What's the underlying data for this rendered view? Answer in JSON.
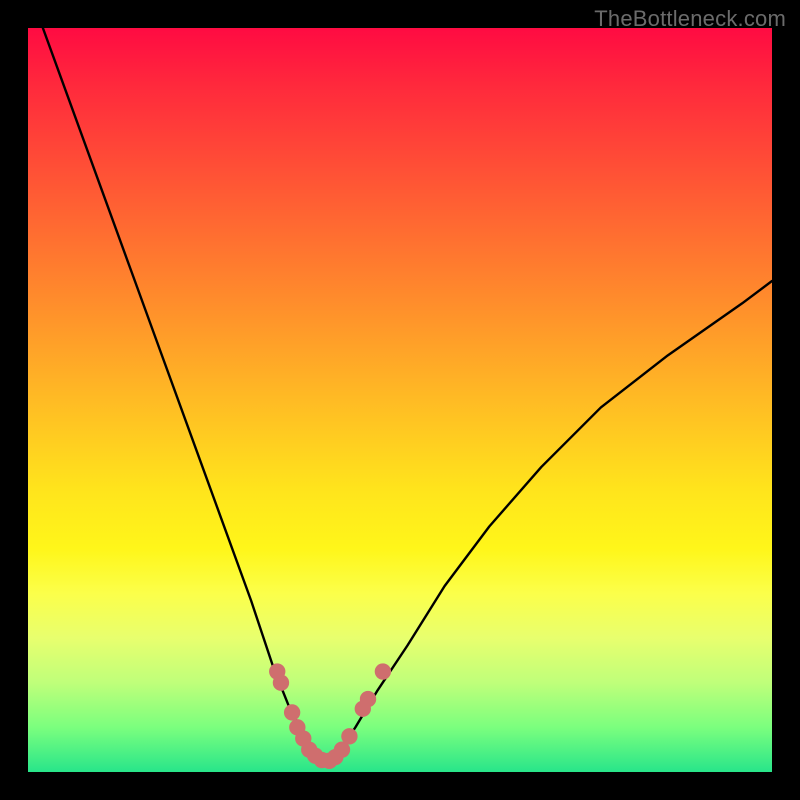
{
  "watermark": "TheBottleneck.com",
  "colors": {
    "curve": "#000000",
    "markers": "#cf6e6e",
    "frame": "#000000"
  },
  "chart_data": {
    "type": "line",
    "title": "",
    "xlabel": "",
    "ylabel": "",
    "xlim": [
      0,
      100
    ],
    "ylim": [
      0,
      100
    ],
    "series": [
      {
        "name": "bottleneck-curve",
        "x": [
          2,
          6,
          10,
          14,
          18,
          22,
          26,
          30,
          33,
          35,
          37,
          38,
          39,
          40,
          41,
          42,
          44,
          47,
          51,
          56,
          62,
          69,
          77,
          86,
          96,
          100
        ],
        "values": [
          100,
          89,
          78,
          67,
          56,
          45,
          34,
          23,
          14,
          9,
          5,
          3,
          2,
          1.5,
          2,
          3,
          6,
          11,
          17,
          25,
          33,
          41,
          49,
          56,
          63,
          66
        ]
      }
    ],
    "markers": [
      {
        "x": 33.5,
        "y": 13.5
      },
      {
        "x": 34.0,
        "y": 12.0
      },
      {
        "x": 35.5,
        "y": 8.0
      },
      {
        "x": 36.2,
        "y": 6.0
      },
      {
        "x": 37.0,
        "y": 4.5
      },
      {
        "x": 37.8,
        "y": 3.0
      },
      {
        "x": 38.6,
        "y": 2.2
      },
      {
        "x": 39.5,
        "y": 1.6
      },
      {
        "x": 40.5,
        "y": 1.5
      },
      {
        "x": 41.3,
        "y": 2.0
      },
      {
        "x": 42.2,
        "y": 3.0
      },
      {
        "x": 43.2,
        "y": 4.8
      },
      {
        "x": 45.0,
        "y": 8.5
      },
      {
        "x": 45.7,
        "y": 9.8
      },
      {
        "x": 47.7,
        "y": 13.5
      }
    ],
    "marker_radius": 1.1
  }
}
